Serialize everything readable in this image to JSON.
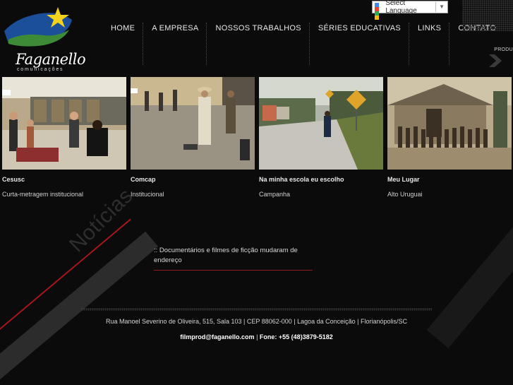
{
  "logo": {
    "name": "Faganello",
    "subtitle": "comunicações"
  },
  "nav": {
    "items": [
      "HOME",
      "A EMPRESA",
      "NOSSOS TRABALHOS",
      "SÉRIES EDUCATIVAS",
      "LINKS",
      "CONTATO"
    ]
  },
  "language": {
    "label": "Select Language",
    "arrow": "▼"
  },
  "side_label": "PRODU",
  "works": [
    {
      "title": "Cesusc",
      "subtitle": "Curta-metragem institucional"
    },
    {
      "title": "Comcap",
      "subtitle": "Institucional"
    },
    {
      "title": "Na minha escola eu escolho",
      "subtitle": "Campanha"
    },
    {
      "title": "Meu Lugar",
      "subtitle": "Alto Uruguai"
    }
  ],
  "news": {
    "heading": "Notícias",
    "items": [
      {
        "text": ":: Documentários e filmes de ficção mudaram de endereço"
      }
    ]
  },
  "footer": {
    "address": "Rua Manoel Severino de Oliveira, 515, Sala 103 | CEP 88062-000 | Lagoa da Conceição | Florianópolis/SC",
    "email": "filmprod@faganello.com",
    "separator": "|",
    "phone": "Fone: +55 (48)3879-5182"
  }
}
